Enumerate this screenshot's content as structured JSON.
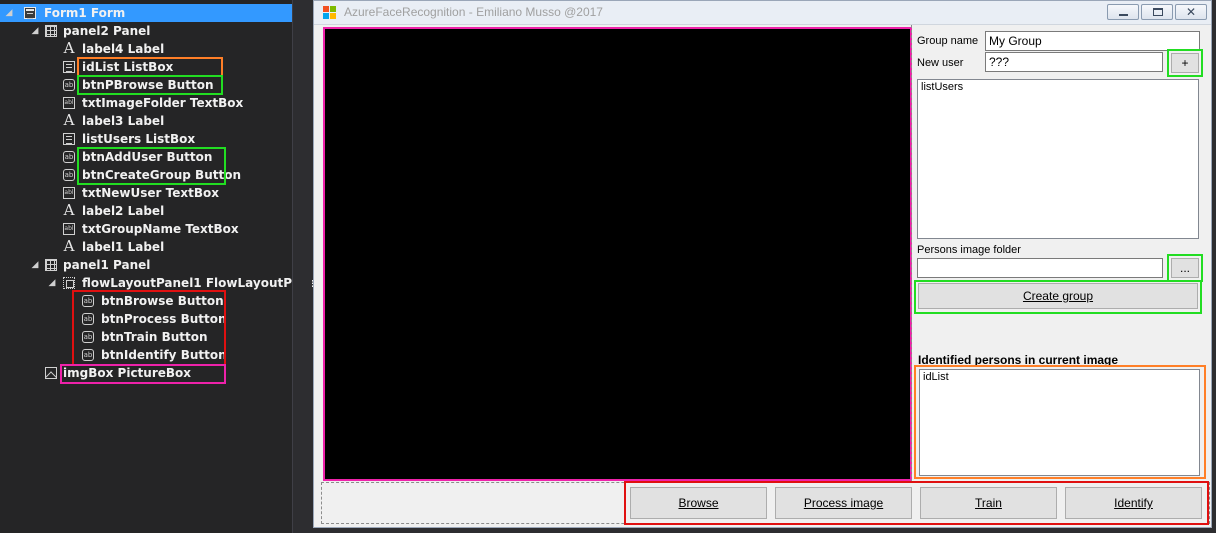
{
  "outline": {
    "items": [
      {
        "name": "Form1",
        "type": "Form",
        "icon": "form-icon"
      },
      {
        "name": "panel2",
        "type": "Panel",
        "icon": "panel-icon"
      },
      {
        "name": "label4",
        "type": "Label",
        "icon": "label-icon"
      },
      {
        "name": "idList",
        "type": "ListBox",
        "icon": "listbox-icon"
      },
      {
        "name": "btnPBrowse",
        "type": "Button",
        "icon": "button-icon"
      },
      {
        "name": "txtImageFolder",
        "type": "TextBox",
        "icon": "textbox-icon"
      },
      {
        "name": "label3",
        "type": "Label",
        "icon": "label-icon"
      },
      {
        "name": "listUsers",
        "type": "ListBox",
        "icon": "listbox-icon"
      },
      {
        "name": "btnAddUser",
        "type": "Button",
        "icon": "button-icon"
      },
      {
        "name": "btnCreateGroup",
        "type": "Button",
        "icon": "button-icon"
      },
      {
        "name": "txtNewUser",
        "type": "TextBox",
        "icon": "textbox-icon"
      },
      {
        "name": "label2",
        "type": "Label",
        "icon": "label-icon"
      },
      {
        "name": "txtGroupName",
        "type": "TextBox",
        "icon": "textbox-icon"
      },
      {
        "name": "label1",
        "type": "Label",
        "icon": "label-icon"
      },
      {
        "name": "panel1",
        "type": "Panel",
        "icon": "panel-icon"
      },
      {
        "name": "flowLayoutPanel1",
        "type": "FlowLayoutPanel",
        "icon": "flowlayoutpanel-icon"
      },
      {
        "name": "btnBrowse",
        "type": "Button",
        "icon": "button-icon"
      },
      {
        "name": "btnProcess",
        "type": "Button",
        "icon": "button-icon"
      },
      {
        "name": "btnTrain",
        "type": "Button",
        "icon": "button-icon"
      },
      {
        "name": "btnIdentify",
        "type": "Button",
        "icon": "button-icon"
      },
      {
        "name": "imgBox",
        "type": "PictureBox",
        "icon": "picturebox-icon"
      }
    ],
    "button_glyph": "ab",
    "textbox_glyph": "abl",
    "label_glyph": "A"
  },
  "form": {
    "title": "AzureFaceRecognition - Emiliano Musso @2017",
    "close_glyph": "✕",
    "group_name_label": "Group name",
    "group_name_value": "My Group",
    "new_user_label": "New user",
    "new_user_value": "???",
    "add_user_label": "+",
    "list_users_text": "listUsers",
    "persons_folder_label": "Persons image folder",
    "persons_folder_value": "",
    "browse_folder_label": "...",
    "create_group_label": "Create group",
    "identified_label": "Identified persons in current image",
    "id_list_text": "idList",
    "buttons": {
      "browse": "Browse",
      "process": "Process image",
      "train": "Train",
      "identify": "Identify"
    }
  },
  "colors": {
    "selection": "#3399ff",
    "annotation_orange": "#ff7f27",
    "annotation_green": "#22dd22",
    "annotation_red": "#e01010",
    "annotation_magenta": "#ee22aa"
  }
}
